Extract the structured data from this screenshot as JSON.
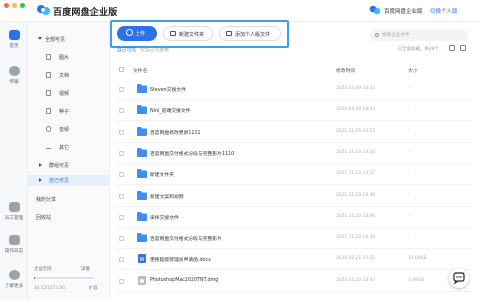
{
  "app": {
    "title": "百度网盘企业版"
  },
  "header": {
    "org_name": "百度网盘企业版",
    "switch_label": "切换个人版",
    "accent": "#2a72e5"
  },
  "rail": {
    "items": [
      {
        "label": "首页",
        "icon": "home-icon",
        "active": true
      },
      {
        "label": "传输",
        "icon": "transfer-icon",
        "active": false
      },
      {
        "label": "员工管理",
        "icon": "staff-icon",
        "active": false
      },
      {
        "label": "操作日志",
        "icon": "log-icon",
        "active": false
      },
      {
        "label": "了解更多",
        "icon": "info-icon",
        "active": false
      }
    ]
  },
  "sidebar": {
    "all_label": "全部可见",
    "sub_items": [
      "图片",
      "文档",
      "视频",
      "种子",
      "音频",
      "其它"
    ],
    "group_label": "群组可见",
    "self_label": "自己可见",
    "share_label": "我的分享",
    "recycle_label": "回收站",
    "quota_label": "企业空间",
    "detail_label": "详情",
    "quota_value": "34.52/1672.0G",
    "quota_ratio": 0.02,
    "expand_label": "扩容"
  },
  "toolbar": {
    "upload_label": "上传",
    "new_folder_label": "新建文件夹",
    "add_personal_label": "添加个人版文件"
  },
  "search": {
    "placeholder": "搜索企业文件"
  },
  "breadcrumb": {
    "current": "自己可见",
    "sub": "仅自己可查看"
  },
  "list_meta": {
    "loaded": "已全部加载，共29个"
  },
  "table": {
    "headers": {
      "name": "文件名",
      "date": "修改时间",
      "size": "大小"
    },
    "rows": [
      {
        "name": "Steven交接文件",
        "date": "2020.03.09 16:33",
        "size": "-",
        "type": "folder"
      },
      {
        "name": "Nini_前端交接文件",
        "date": "2020.03.09 16:33",
        "size": "-",
        "type": "folder"
      },
      {
        "name": "百度网盘修改更新1111",
        "date": "2021.11.05 10:53",
        "size": "-",
        "type": "folder"
      },
      {
        "name": "百度网盘交付格式分段与完整影片1110",
        "date": "2021.11.10 14:56",
        "size": "-",
        "type": "folder"
      },
      {
        "name": "新建文件夹",
        "date": "2021.11.10 14:57",
        "size": "-",
        "type": "folder"
      },
      {
        "name": "新建文案和视频",
        "date": "2021.11.20 16:46",
        "size": "-",
        "type": "folder"
      },
      {
        "name": "采样交接文件",
        "date": "2021.11.20 16:46",
        "size": "-",
        "type": "folder"
      },
      {
        "name": "百度网盘交付格式分段与完整影片",
        "date": "2021.11.20 16:46",
        "size": "-",
        "type": "folder"
      },
      {
        "name": "更换超级管理员申请函.docx",
        "date": "2020.02.21 15:52",
        "size": "12.64KB",
        "type": "doc"
      },
      {
        "name": "PhotoshopMac2020TNT.dmg",
        "date": "2020.01.20 16:47",
        "size": "1.99GB",
        "type": "dmg"
      }
    ]
  }
}
